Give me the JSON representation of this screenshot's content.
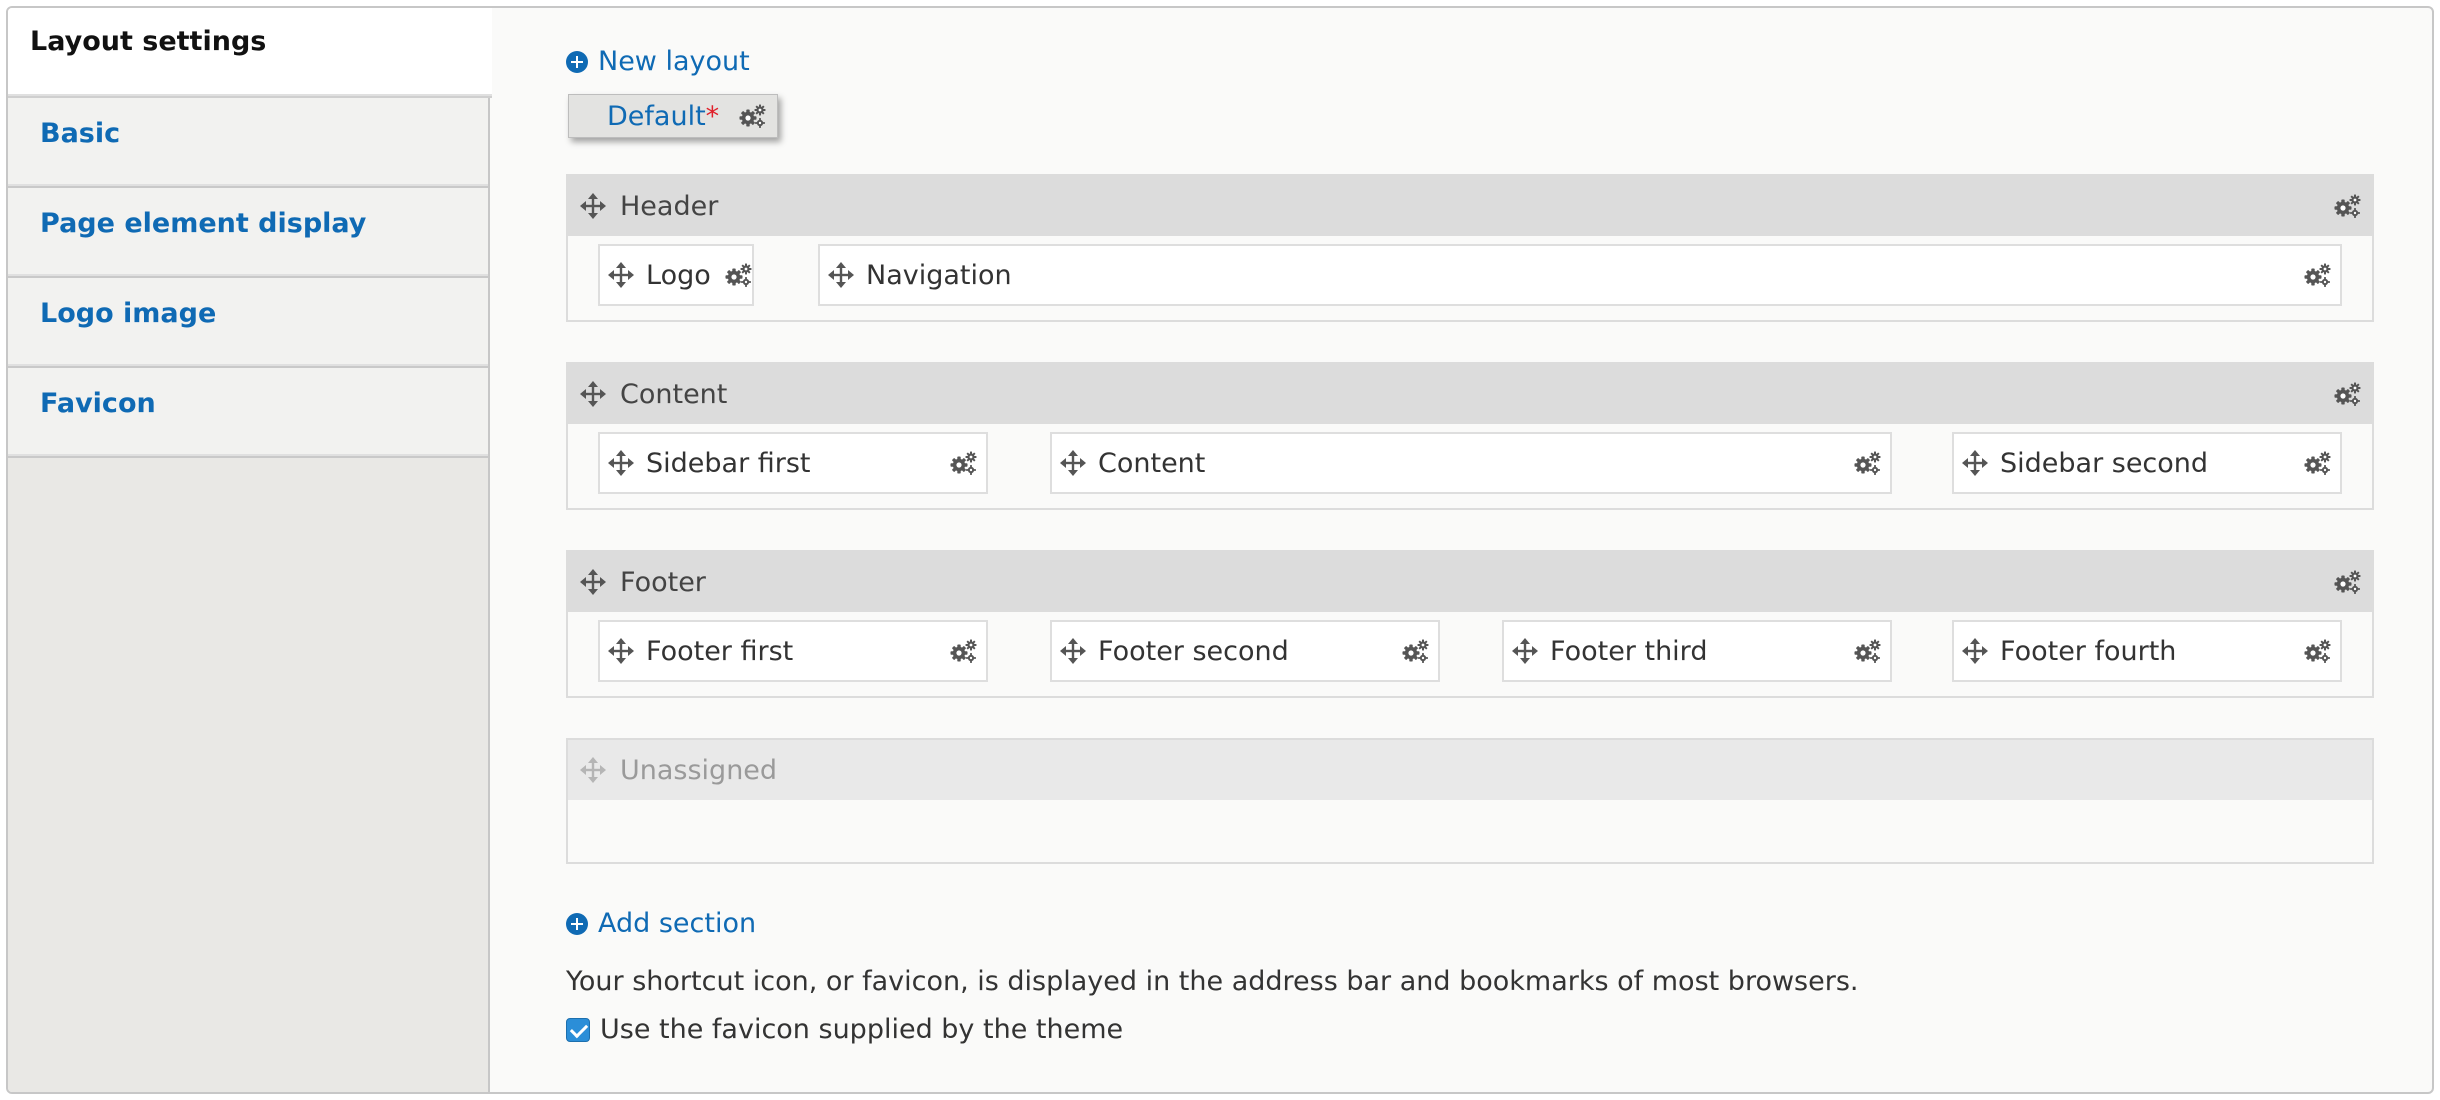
{
  "sidebar": {
    "title": "Layout settings",
    "items": [
      {
        "label": "Basic"
      },
      {
        "label": "Page element display"
      },
      {
        "label": "Logo image"
      },
      {
        "label": "Favicon"
      }
    ]
  },
  "main": {
    "new_layout_label": "New layout",
    "layout_tab": {
      "label": "Default",
      "modified_marker": "*"
    },
    "sections": [
      {
        "title": "Header",
        "regions": [
          "Logo",
          "Navigation"
        ]
      },
      {
        "title": "Content",
        "regions": [
          "Sidebar first",
          "Content",
          "Sidebar second"
        ]
      },
      {
        "title": "Footer",
        "regions": [
          "Footer first",
          "Footer second",
          "Footer third",
          "Footer fourth"
        ]
      },
      {
        "title": "Unassigned",
        "regions": []
      }
    ],
    "add_section_label": "Add section",
    "favicon_help": "Your shortcut icon, or favicon, is displayed in the address bar and bookmarks of most browsers.",
    "use_default_favicon": {
      "label": "Use the favicon supplied by the theme",
      "checked": true
    }
  },
  "colors": {
    "link": "#0f6ab4",
    "marker": "#e0202a",
    "section_header": "#dcdcdc",
    "checkbox": "#2b8ed8"
  },
  "icons": {
    "move": "move-icon",
    "gear": "gear-icon",
    "add": "plus-circle-icon"
  }
}
